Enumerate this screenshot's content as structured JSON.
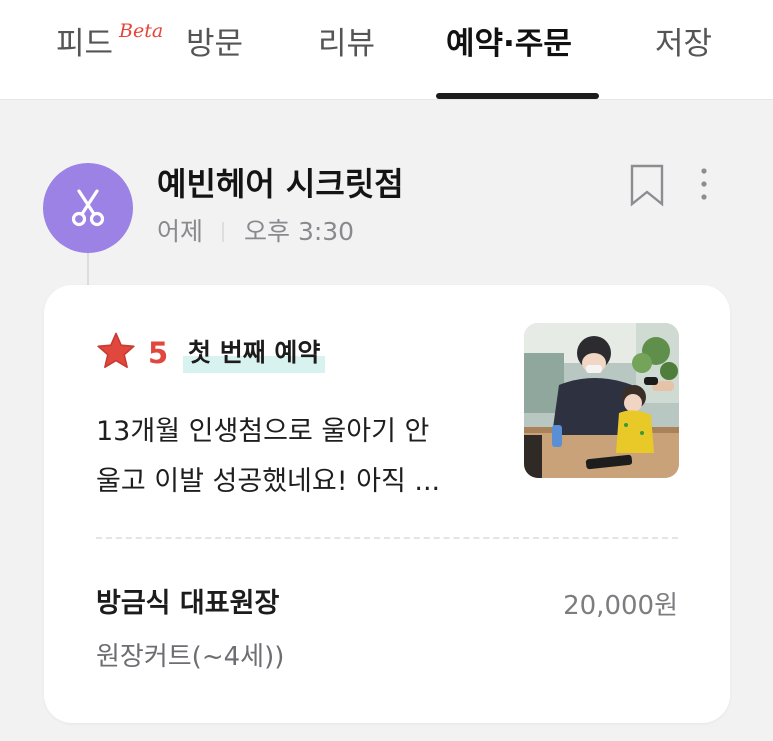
{
  "tabs": {
    "feed": "피드",
    "feed_badge": "Beta",
    "visit": "방문",
    "review": "리뷰",
    "reservation_order": "예약·주문",
    "saved": "저장"
  },
  "active_tab": "reservation_order",
  "post": {
    "shop_name": "예빈헤어 시크릿점",
    "date": "어제",
    "time": "오후 3:30",
    "avatar_icon": "scissors-icon",
    "avatar_color": "#9b82e4"
  },
  "review": {
    "rating": "5",
    "badge": "첫 번째 예약",
    "text_lines": [
      "13개월 인생첨으로 울아기 안",
      "울고 이발 성공했네요! 아직 ..."
    ],
    "photo_description_icon": "review-photo"
  },
  "reservation": {
    "staff": "방금식 대표원장",
    "price": "20,000원",
    "service": "원장커트(~4세))"
  },
  "colors": {
    "accent_red": "#e0473d",
    "badge_highlight": "#d8f2f0",
    "indicator": "#1c1c1c"
  }
}
